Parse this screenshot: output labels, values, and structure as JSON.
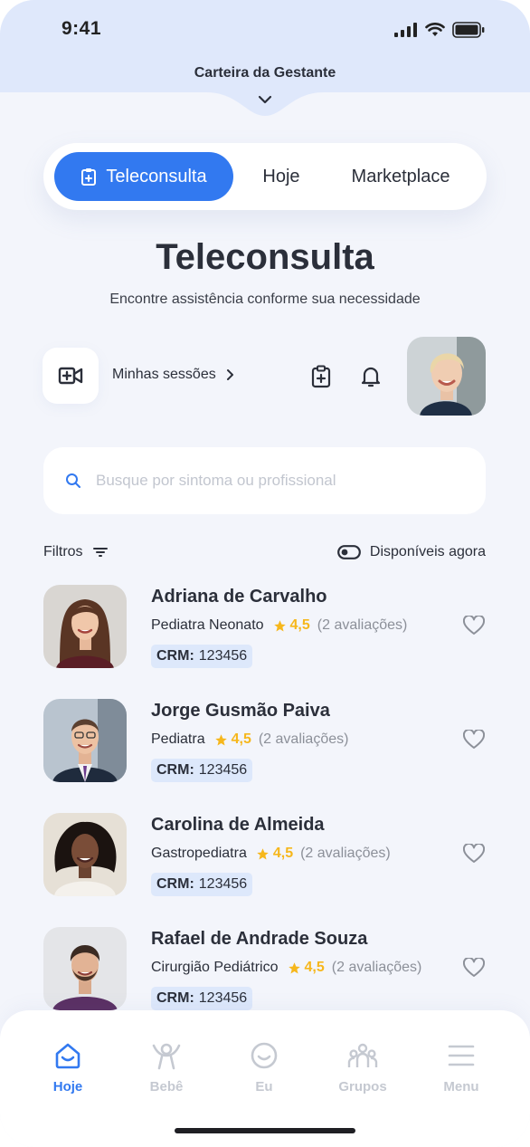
{
  "status": {
    "time": "9:41"
  },
  "header": {
    "app_title": "Carteira da Gestante"
  },
  "tabs": [
    {
      "label": "Teleconsulta",
      "active": true
    },
    {
      "label": "Hoje",
      "active": false
    },
    {
      "label": "Marketplace",
      "active": false
    }
  ],
  "page": {
    "title": "Teleconsulta",
    "subtitle": "Encontre assistência conforme sua necessidade",
    "sessions_label": "Minhas sessões"
  },
  "search": {
    "placeholder": "Busque por sintoma ou profissional",
    "value": ""
  },
  "filters": {
    "label": "Filtros",
    "available_label": "Disponíveis agora",
    "available_on": false
  },
  "doctors": [
    {
      "name": "Adriana de Carvalho",
      "specialty": "Pediatra Neonato",
      "rating": "4,5",
      "reviews": "(2 avaliações)",
      "crm_label": "CRM:",
      "crm": "123456"
    },
    {
      "name": "Jorge Gusmão Paiva",
      "specialty": "Pediatra",
      "rating": "4,5",
      "reviews": "(2 avaliações)",
      "crm_label": "CRM:",
      "crm": "123456"
    },
    {
      "name": "Carolina de Almeida",
      "specialty": "Gastropediatra",
      "rating": "4,5",
      "reviews": "(2 avaliações)",
      "crm_label": "CRM:",
      "crm": "123456"
    },
    {
      "name": "Rafael de Andrade Souza",
      "specialty": "Cirurgião Pediátrico",
      "rating": "4,5",
      "reviews": "(2 avaliações)",
      "crm_label": "CRM:",
      "crm": "123456"
    }
  ],
  "nav": [
    {
      "label": "Hoje",
      "icon": "home-icon",
      "active": true
    },
    {
      "label": "Bebê",
      "icon": "baby-icon",
      "active": false
    },
    {
      "label": "Eu",
      "icon": "smile-icon",
      "active": false
    },
    {
      "label": "Grupos",
      "icon": "group-icon",
      "active": false
    },
    {
      "label": "Menu",
      "icon": "menu-icon",
      "active": false
    }
  ],
  "colors": {
    "accent": "#3279f0",
    "star": "#f6b71c",
    "header_bg": "#dfe8fb",
    "page_bg": "#f3f5fb",
    "crm_bg": "#dde8fb"
  }
}
